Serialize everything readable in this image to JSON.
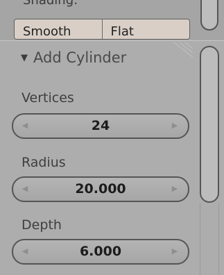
{
  "shading": {
    "label": "Shading:",
    "buttons": [
      "Smooth",
      "Flat"
    ]
  },
  "operator": {
    "title": "Add Cylinder",
    "collapse_icon": "triangle-down-icon"
  },
  "fields": [
    {
      "label": "Vertices",
      "value": "24"
    },
    {
      "label": "Radius",
      "value": "20.000"
    },
    {
      "label": "Depth",
      "value": "6.000"
    }
  ],
  "icons": {
    "decrement": "arrow-left-icon",
    "increment": "arrow-right-icon",
    "grip": "resize-grip-icon"
  }
}
